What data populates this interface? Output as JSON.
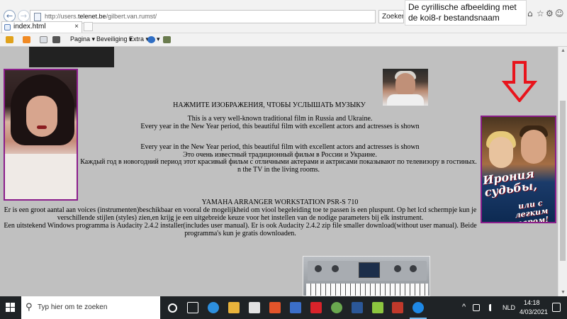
{
  "browser": {
    "back_glyph": "←",
    "forward_glyph": "→",
    "url_prefix": "http://users.",
    "url_domain": "telenet.be",
    "url_suffix": "/gilbert.van.rumst/",
    "search_placeholder": "Zoeken...",
    "search_icon_glyph": "⌕",
    "tooltip": "De cyrillische afbeelding met de koi8-r bestandsnaam",
    "tab_title": "index.html",
    "tab_close_glyph": "×",
    "commands": {
      "page": "Pagina ▾",
      "security": "Beveiliging ▾",
      "extra": "Extra ▾",
      "help": "▾"
    },
    "window_tools": [
      "⌂",
      "☆",
      "⚙",
      "☺"
    ]
  },
  "page": {
    "russian_heading": "НАЖМИТЕ ИЗОБРАЖЕНИЯ, ЧТОБЫ УСЛЫШАТЬ МУЗЫКУ",
    "line_a": "This is a very well-known traditional film in Russia and Ukraine.",
    "line_b": "Every year in the New Year period, this beautiful film with excellent actors and actresses is shown",
    "line_c": "Every year in the New Year period, this beautiful film with excellent actors and actresses is shown",
    "line_d": "Это очень известный традиционный фильм в России и Украине.",
    "para_ru": "Каждый год в новогодний период этот красивый фильм с отличными актерами и актрисами показывают по телевизору в гостиных. n the TV in the living rooms.",
    "yamaha_heading": "YAMAHA ARRANGER WORKSTATION PSR-S 710",
    "para_nl_1": "Er is een groot aantal aan voices (instrumenten)beschikbaar en vooral de mogelijkheid om viool begeleiding toe te passen is een pluspunt. Op het lcd schermpje kun je verschillende stijlen (styles) zien,en krijg je een uitgebreide keuze voor het instellen van de nodige parameters bij elk instrument.",
    "para_nl_2": "Een uitstekend Windows programma is Audacity 2.4.2 installer(includes user manual). Er is ook Audacity 2.4.2 zip file smaller download(without user manual). Beide programma's kun je gratis downloaden.",
    "poster_title": "Ирония судьбы,",
    "poster_subtitle": "или с легким паром!",
    "accent_arrow_color": "#e8141c",
    "frame_color": "#8b1d8b",
    "page_bg": "#c0c0c0"
  },
  "scrollbar": {
    "up": "▲",
    "down": "▼"
  },
  "taskbar": {
    "search_icon_glyph": "⚲",
    "search_placeholder": "Typ hier om te zoeken",
    "tray_up": "^",
    "language": "NLD",
    "time": "14:18",
    "date": "4/03/2021"
  }
}
